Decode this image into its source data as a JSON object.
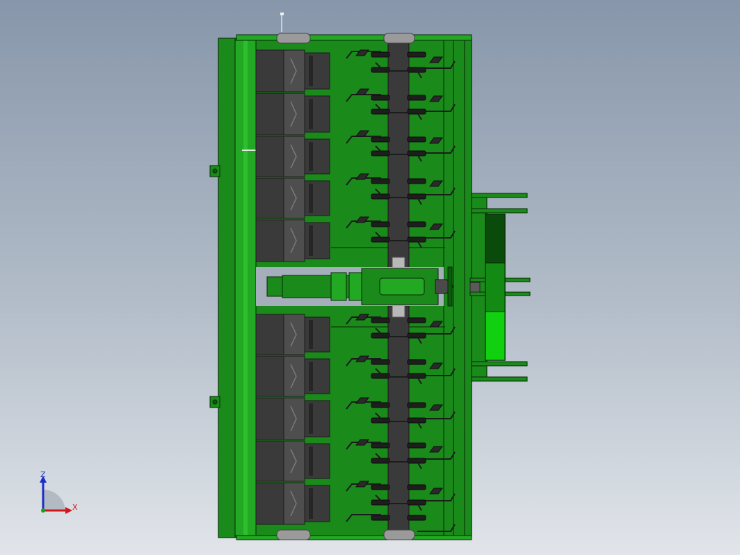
{
  "view": {
    "background_top": "#8796aa",
    "background_bottom": "#e1e5ea",
    "model_name_visible": false
  },
  "colors": {
    "frame_green": "#1a8a1a",
    "frame_green_light": "#22a822",
    "frame_green_dark": "#0c5a0c",
    "edge": "#062806",
    "rotor_dark": "#3a3a3a",
    "rotor_mid": "#4e4e4e",
    "rotor_light": "#6a6a6a",
    "hub_grey": "#9a9a9a",
    "indicator_dark": "#0a4a0a",
    "indicator_mid": "#138a13",
    "indicator_bright": "#10d010"
  },
  "model": {
    "left_rollers": 10,
    "blade_rows": 12,
    "indicator_segments": [
      "dark",
      "mid",
      "bright"
    ]
  },
  "triad": {
    "z_label": "Z",
    "x_label": "X",
    "z_color": "#1a2ec8",
    "x_color": "#d01818",
    "y_color": "#18a018"
  }
}
